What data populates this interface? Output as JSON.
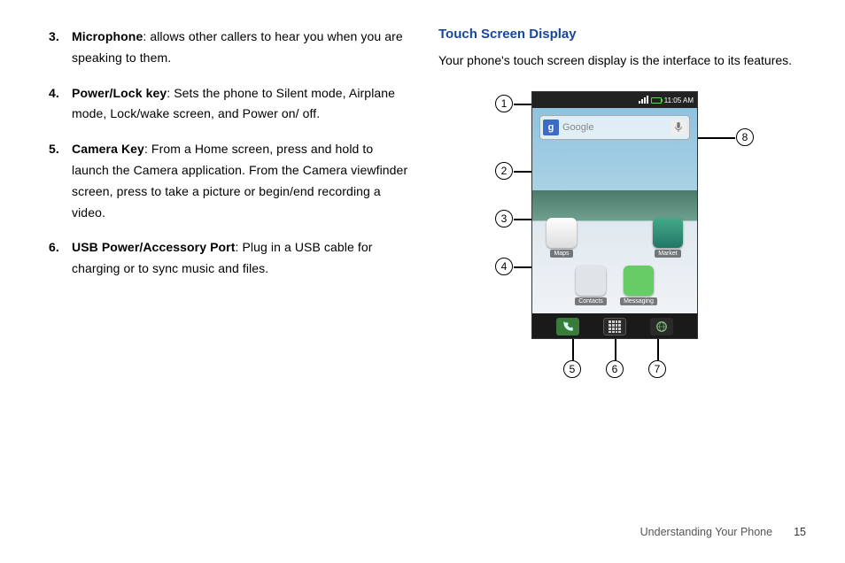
{
  "left": {
    "items": [
      {
        "num": "3.",
        "term": "Microphone",
        "desc": ": allows other callers to hear you when you are speaking to them."
      },
      {
        "num": "4.",
        "term": "Power/Lock key",
        "desc": ": Sets the phone to Silent mode, Airplane mode, Lock/wake screen, and Power on/ off."
      },
      {
        "num": "5.",
        "term": "Camera Key",
        "desc": ": From a Home screen, press and hold to launch the Camera application. From the Camera viewfinder screen, press to take a picture or begin/end recording a video."
      },
      {
        "num": "6.",
        "term": "USB Power/Accessory Port",
        "desc": ": Plug in a USB cable for charging or to sync music and files."
      }
    ]
  },
  "right": {
    "heading": "Touch Screen Display",
    "intro": "Your phone's touch screen display is the interface to its features."
  },
  "phone": {
    "time": "11:05 AM",
    "google_badge": "g",
    "search_placeholder": "Google",
    "apps": {
      "maps": "Maps",
      "market": "Market",
      "contacts": "Contacts",
      "messaging": "Messaging"
    }
  },
  "callouts": {
    "c1": "1",
    "c2": "2",
    "c3": "3",
    "c4": "4",
    "c5": "5",
    "c6": "6",
    "c7": "7",
    "c8": "8"
  },
  "footer": {
    "section": "Understanding Your Phone",
    "page": "15"
  }
}
